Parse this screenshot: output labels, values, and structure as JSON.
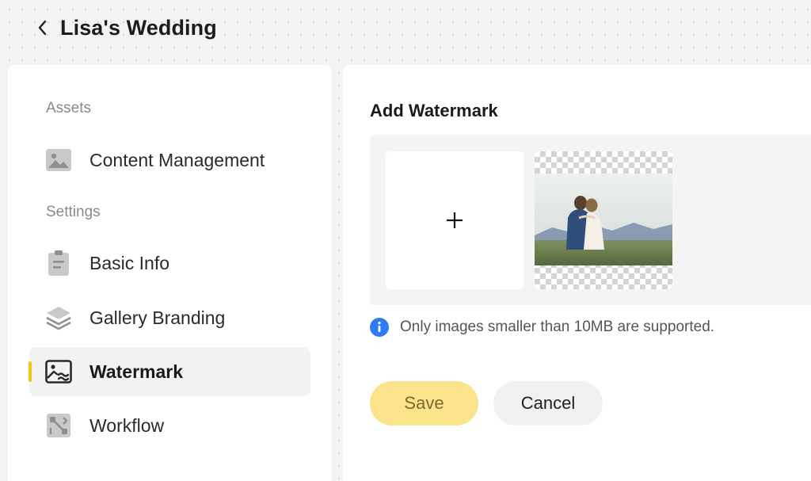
{
  "header": {
    "title": "Lisa's Wedding"
  },
  "sidebar": {
    "sections": [
      {
        "label": "Assets"
      },
      {
        "label": "Settings"
      }
    ],
    "items": [
      {
        "label": "Content Management",
        "icon": "image-icon"
      },
      {
        "label": "Basic Info",
        "icon": "clipboard-icon"
      },
      {
        "label": "Gallery Branding",
        "icon": "layers-icon"
      },
      {
        "label": "Watermark",
        "icon": "watermark-icon",
        "active": true
      },
      {
        "label": "Workflow",
        "icon": "workflow-icon"
      }
    ]
  },
  "main": {
    "section_title": "Add Watermark",
    "upload_symbol": "+",
    "hint": "Only images smaller than 10MB are supported.",
    "save_label": "Save",
    "cancel_label": "Cancel"
  },
  "colors": {
    "accent": "#f5c518",
    "save_bg": "#fbe38c",
    "info": "#2f7bf2"
  }
}
